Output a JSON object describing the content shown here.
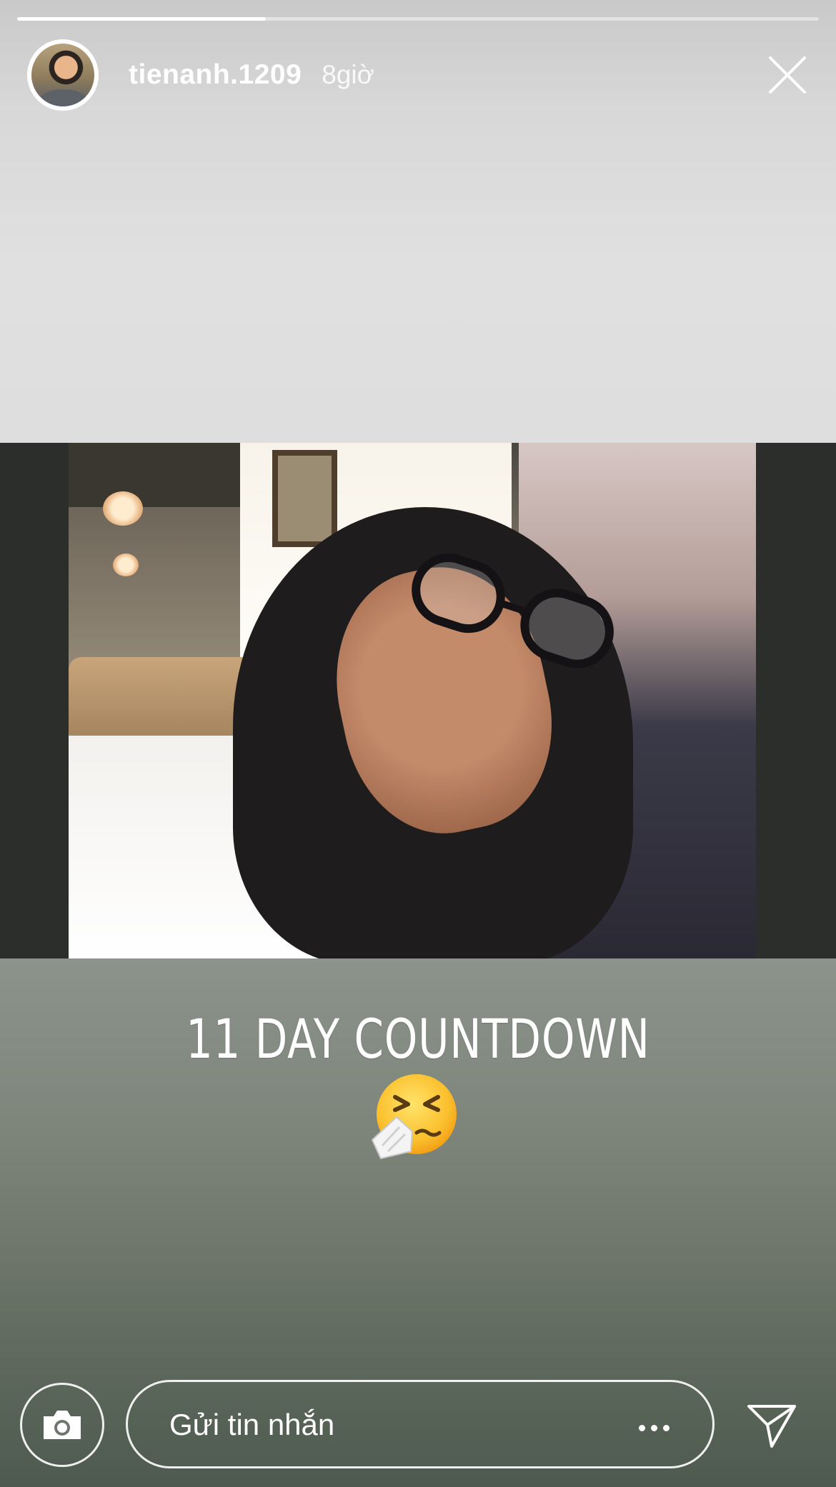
{
  "story": {
    "progress": 0.31,
    "username": "tienanh.1209",
    "time_ago": "8giờ",
    "caption": "11 DAY COUNTDOWN",
    "emoji": "sneezing-face"
  },
  "reply_bar": {
    "placeholder": "Gửi tin nhắn"
  },
  "colors": {
    "text": "#ffffff",
    "photo_band": "#2c2e2b",
    "bottom_bg": "#667063"
  }
}
